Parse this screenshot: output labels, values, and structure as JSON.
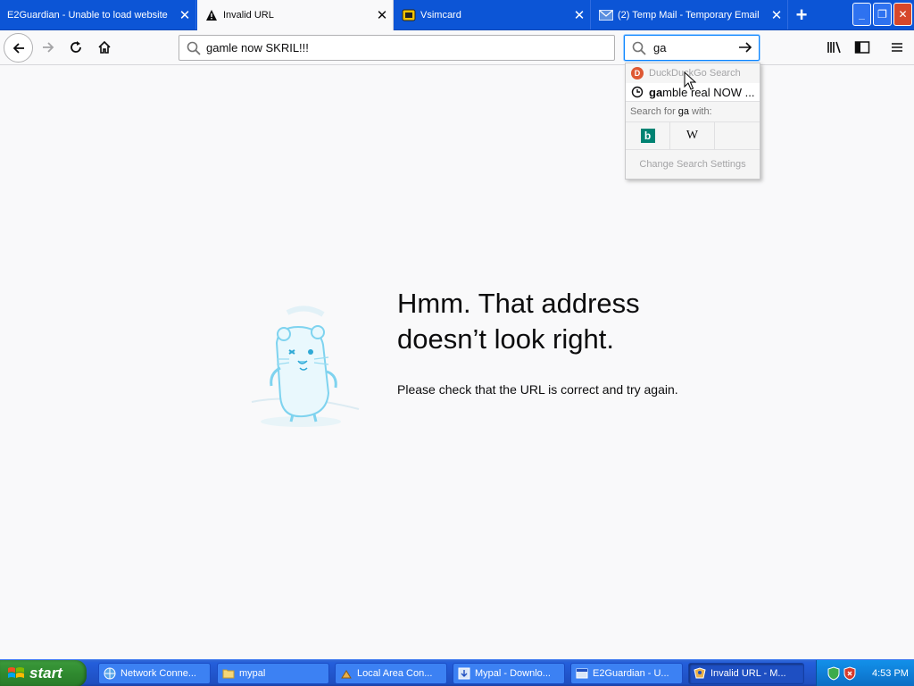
{
  "tabs": [
    {
      "title": "E2Guardian - Unable to load website",
      "active": false
    },
    {
      "title": "Invalid URL",
      "active": true
    },
    {
      "title": "Vsimcard",
      "active": false
    },
    {
      "title": "(2) Temp Mail - Temporary Email",
      "active": false
    }
  ],
  "navbar": {
    "url_text": "gamle now SKRIL!!!",
    "search_text": "ga"
  },
  "search_popup": {
    "engine_name": "DuckDuckGo Search",
    "suggestion_bold": "ga",
    "suggestion_rest": "mble real NOW ...",
    "search_for_prefix": "Search for",
    "search_for_term": "ga",
    "search_for_suffix": "with:",
    "bing_label": "b",
    "wiki_label": "W",
    "settings_label": "Change Search Settings"
  },
  "error": {
    "title_line1": "Hmm. That address",
    "title_line2": "doesn’t look right.",
    "message": "Please check that the URL is correct and try again."
  },
  "taskbar": {
    "start_label": "start",
    "items": [
      {
        "label": "Network Conne...",
        "icon": "network-icon"
      },
      {
        "label": "mypal",
        "icon": "folder-icon"
      },
      {
        "label": "Local Area Con...",
        "icon": "network-connection-icon"
      },
      {
        "label": "Mypal - Downlo...",
        "icon": "download-icon"
      },
      {
        "label": "E2Guardian - U...",
        "icon": "browser-icon"
      },
      {
        "label": "Invalid URL - M...",
        "icon": "browser-icon"
      }
    ],
    "clock": "4:53 PM"
  },
  "colors": {
    "tabstrip": "#0c55d6",
    "page_bg": "#f9f9fa",
    "taskbar": "#245edb",
    "start": "#2f8a2f"
  }
}
